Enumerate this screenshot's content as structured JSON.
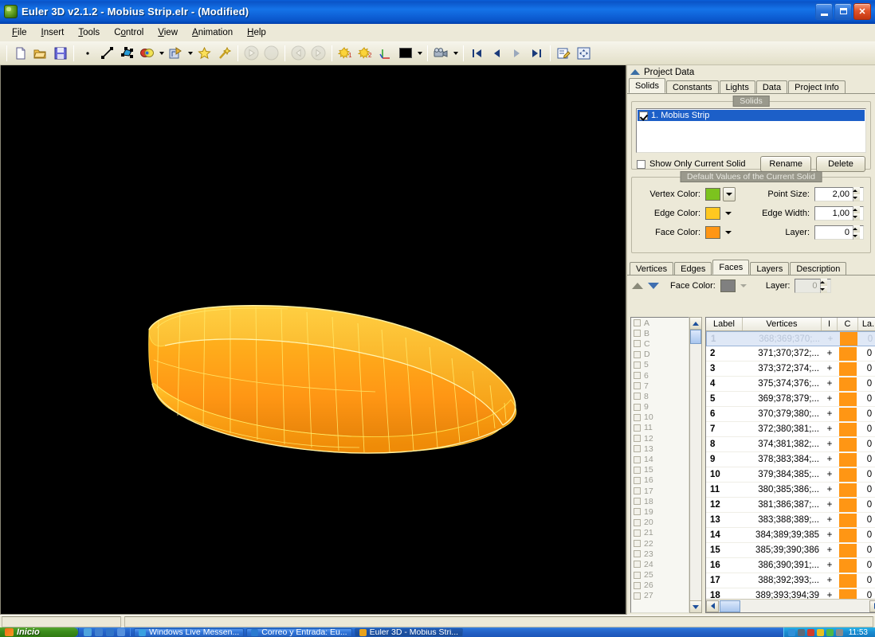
{
  "window": {
    "title": "Euler 3D v2.1.2 - Mobius Strip.elr - (Modified)",
    "app_icon": "euler3d-icon",
    "minimize_label": "Minimize",
    "maximize_label": "Restore",
    "close_label": "Close"
  },
  "menu": [
    {
      "label": "File",
      "accel": "F"
    },
    {
      "label": "Insert",
      "accel": "I"
    },
    {
      "label": "Tools",
      "accel": "T"
    },
    {
      "label": "Control",
      "accel": "C"
    },
    {
      "label": "View",
      "accel": "V"
    },
    {
      "label": "Animation",
      "accel": "A"
    },
    {
      "label": "Help",
      "accel": "H"
    }
  ],
  "toolbar": {
    "groups": [
      {
        "items": [
          {
            "name": "new-file-icon",
            "tip": "New"
          },
          {
            "name": "open-folder-icon",
            "tip": "Open"
          },
          {
            "name": "save-disk-icon",
            "tip": "Save"
          }
        ]
      },
      {
        "items": [
          {
            "name": "point-icon",
            "tip": "Insert Point"
          },
          {
            "name": "line-icon",
            "tip": "Insert Line"
          },
          {
            "name": "polygon-icon",
            "tip": "Insert Polygon"
          },
          {
            "name": "palette-icon",
            "tip": "Colors",
            "has_dropdown": true
          },
          {
            "name": "transform-icon",
            "tip": "Transform",
            "has_dropdown": true
          },
          {
            "name": "star-icon",
            "tip": "Favorites"
          },
          {
            "name": "magic-wand-icon",
            "tip": "Wizard"
          }
        ]
      },
      {
        "items": [
          {
            "name": "play-icon",
            "tip": "Play",
            "disabled": true
          },
          {
            "name": "stop-icon",
            "tip": "Stop",
            "disabled": true
          },
          {
            "name": "rewind-icon",
            "tip": "Rewind",
            "disabled": true
          },
          {
            "name": "forward-icon",
            "tip": "Forward",
            "disabled": true
          }
        ]
      },
      {
        "items": [
          {
            "name": "light1-icon",
            "tip": "Light 1"
          },
          {
            "name": "light2-icon",
            "tip": "Light 2"
          },
          {
            "name": "axes-icon",
            "tip": "Axes"
          },
          {
            "name": "background-color-swatch",
            "tip": "Background Color",
            "has_dropdown": true,
            "color": "#000000"
          },
          {
            "name": "camera-icon",
            "tip": "Camera",
            "has_dropdown": true
          }
        ]
      },
      {
        "items": [
          {
            "name": "first-frame-icon",
            "tip": "First"
          },
          {
            "name": "prev-frame-icon",
            "tip": "Previous"
          },
          {
            "name": "next-frame-icon",
            "tip": "Next"
          },
          {
            "name": "last-frame-icon",
            "tip": "Last"
          }
        ]
      },
      {
        "items": [
          {
            "name": "edit-note-icon",
            "tip": "Edit Note"
          },
          {
            "name": "move-resize-icon",
            "tip": "Move / Resize"
          }
        ]
      }
    ]
  },
  "viewport": {
    "name": "3d-viewport",
    "background_color": "#000000",
    "model_name": "Mobius Strip",
    "face_color": "#ff9614",
    "edge_color": "#ffe14a",
    "highlight_color": "#ffd04a"
  },
  "panel": {
    "header": "Project Data",
    "tabs": [
      {
        "label": "Solids",
        "active": true
      },
      {
        "label": "Constants",
        "active": false
      },
      {
        "label": "Lights",
        "active": false
      },
      {
        "label": "Data",
        "active": false
      },
      {
        "label": "Project Info",
        "active": false
      }
    ],
    "solids_group": {
      "title": "Solids",
      "items": [
        {
          "label": "1. Mobius Strip",
          "checked": true,
          "selected": true
        }
      ],
      "show_only_current": {
        "label": "Show Only Current Solid",
        "checked": false
      },
      "rename_label": "Rename",
      "delete_label": "Delete"
    },
    "defaults_group": {
      "title": "Default Values of the Current Solid",
      "vertex_color_label": "Vertex Color:",
      "vertex_color": "#7cc31e",
      "edge_color_label": "Edge Color:",
      "edge_color": "#ffc820",
      "face_color_label": "Face Color:",
      "face_color": "#ff9614",
      "point_size_label": "Point Size:",
      "point_size": "2,00",
      "edge_width_label": "Edge Width:",
      "edge_width": "1,00",
      "layer_label": "Layer:",
      "layer": "0"
    },
    "sub_tabs": [
      {
        "label": "Vertices",
        "active": false
      },
      {
        "label": "Edges",
        "active": false
      },
      {
        "label": "Faces",
        "active": true
      },
      {
        "label": "Layers",
        "active": false
      },
      {
        "label": "Description",
        "active": false
      }
    ],
    "face_row": {
      "face_color_label": "Face Color:",
      "face_color": "#808080",
      "layer_label": "Layer:",
      "layer": "0"
    },
    "layer_list": [
      "A",
      "B",
      "C",
      "D",
      "5",
      "6",
      "7",
      "8",
      "9",
      "10",
      "11",
      "12",
      "13",
      "14",
      "15",
      "16",
      "17",
      "18",
      "19",
      "20",
      "21",
      "22",
      "23",
      "24",
      "25",
      "26",
      "27"
    ],
    "faces_table": {
      "columns": [
        "Label",
        "Vertices",
        "I",
        "C",
        "La.."
      ],
      "rows": [
        {
          "label": "1",
          "vertices": "368;369;370;...",
          "i": "+",
          "c": "#ff9614",
          "la": "0",
          "selected": true
        },
        {
          "label": "2",
          "vertices": "371;370;372;...",
          "i": "+",
          "c": "#ff9614",
          "la": "0",
          "selected": false
        },
        {
          "label": "3",
          "vertices": "373;372;374;...",
          "i": "+",
          "c": "#ff9614",
          "la": "0",
          "selected": false
        },
        {
          "label": "4",
          "vertices": "375;374;376;...",
          "i": "+",
          "c": "#ff9614",
          "la": "0",
          "selected": false
        },
        {
          "label": "5",
          "vertices": "369;378;379;...",
          "i": "+",
          "c": "#ff9614",
          "la": "0",
          "selected": false
        },
        {
          "label": "6",
          "vertices": "370;379;380;...",
          "i": "+",
          "c": "#ff9614",
          "la": "0",
          "selected": false
        },
        {
          "label": "7",
          "vertices": "372;380;381;...",
          "i": "+",
          "c": "#ff9614",
          "la": "0",
          "selected": false
        },
        {
          "label": "8",
          "vertices": "374;381;382;...",
          "i": "+",
          "c": "#ff9614",
          "la": "0",
          "selected": false
        },
        {
          "label": "9",
          "vertices": "378;383;384;...",
          "i": "+",
          "c": "#ff9614",
          "la": "0",
          "selected": false
        },
        {
          "label": "10",
          "vertices": "379;384;385;...",
          "i": "+",
          "c": "#ff9614",
          "la": "0",
          "selected": false
        },
        {
          "label": "11",
          "vertices": "380;385;386;...",
          "i": "+",
          "c": "#ff9614",
          "la": "0",
          "selected": false
        },
        {
          "label": "12",
          "vertices": "381;386;387;...",
          "i": "+",
          "c": "#ff9614",
          "la": "0",
          "selected": false
        },
        {
          "label": "13",
          "vertices": "383;388;389;...",
          "i": "+",
          "c": "#ff9614",
          "la": "0",
          "selected": false
        },
        {
          "label": "14",
          "vertices": "384;389;39;385",
          "i": "+",
          "c": "#ff9614",
          "la": "0",
          "selected": false
        },
        {
          "label": "15",
          "vertices": "385;39;390;386",
          "i": "+",
          "c": "#ff9614",
          "la": "0",
          "selected": false
        },
        {
          "label": "16",
          "vertices": "386;390;391;...",
          "i": "+",
          "c": "#ff9614",
          "la": "0",
          "selected": false
        },
        {
          "label": "17",
          "vertices": "388;392;393;...",
          "i": "+",
          "c": "#ff9614",
          "la": "0",
          "selected": false
        },
        {
          "label": "18",
          "vertices": "389;393;394;39",
          "i": "+",
          "c": "#ff9614",
          "la": "0",
          "selected": false
        }
      ]
    }
  },
  "taskbar": {
    "start_label": "Inicio",
    "quicklaunch": [
      {
        "name": "show-desktop-icon",
        "color": "#4ea3dd"
      },
      {
        "name": "internet-explorer-icon",
        "color": "#3f7fcf"
      },
      {
        "name": "messenger-icon",
        "color": "#2f73c8"
      },
      {
        "name": "more-chevron-icon",
        "color": "#5590dd"
      }
    ],
    "tasks": [
      {
        "label": "Windows Live Messen...",
        "icon": "messenger-icon",
        "active": false
      },
      {
        "label": "Correo y Entrada: Eu...",
        "icon": "mail-icon",
        "active": false
      },
      {
        "label": "Euler 3D - Mobius Stri...",
        "icon": "euler3d-icon",
        "active": true
      }
    ],
    "tray_icons": [
      {
        "name": "security-shield-icon",
        "color": "#2f8fd8"
      },
      {
        "name": "volume-icon",
        "color": "#5a6a7a"
      },
      {
        "name": "network-icon",
        "color": "#d03c2c"
      },
      {
        "name": "antivirus-icon",
        "color": "#e8c020"
      },
      {
        "name": "updates-icon",
        "color": "#4eb848"
      },
      {
        "name": "printer-icon",
        "color": "#8a8a8a"
      }
    ],
    "clock": "11:53"
  }
}
